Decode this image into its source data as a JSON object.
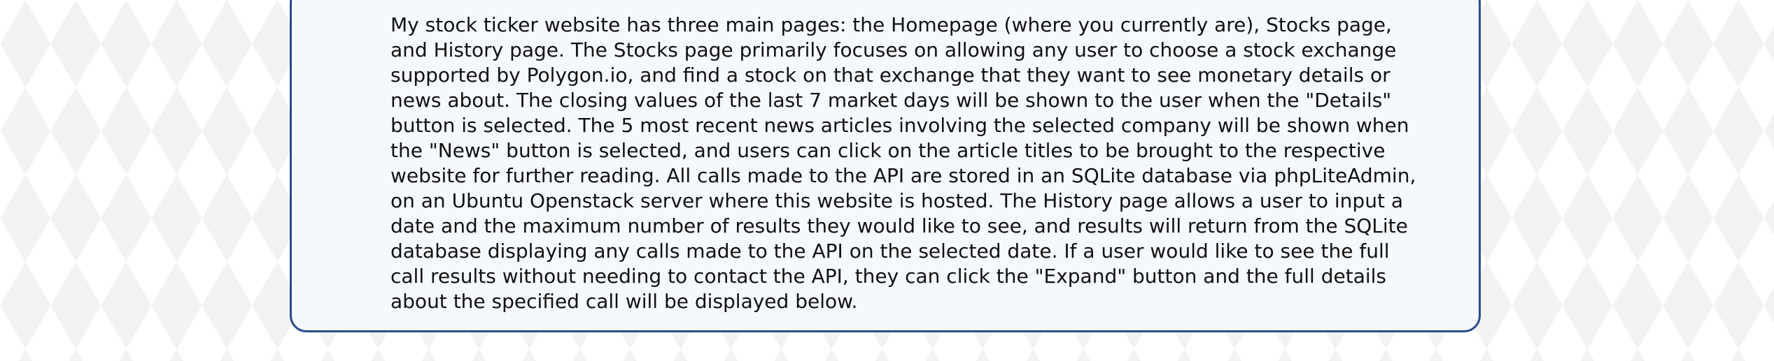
{
  "card": {
    "lines": [
      "My stock ticker website has three main pages: the Homepage (where you currently are), Stocks page,",
      "and History page. The Stocks page primarily focuses on allowing any user to choose a stock exchange",
      "supported by Polygon.io, and find a stock on that exchange that they want to see monetary details or",
      "news about. The closing values of the last 7 market days will be shown to the user when the \"Details\"",
      "button is selected. The 5 most recent news articles involving the selected company will be shown when",
      "the \"News\" button is selected, and users can click on the article titles to be brought to the respective",
      "website for further reading. All calls made to the API are stored in an SQLite database via phpLiteAdmin,",
      "on an Ubuntu Openstack server where this website is hosted. The History page allows a user to input a",
      "date and the maximum number of results they would like to see, and results will return from the SQLite",
      "database displaying any calls made to the API on the selected date. If a user would like to see the full",
      "call results without needing to contact the API, they can click the \"Expand\" button and the full details",
      "about the specified call will be displayed below."
    ]
  }
}
